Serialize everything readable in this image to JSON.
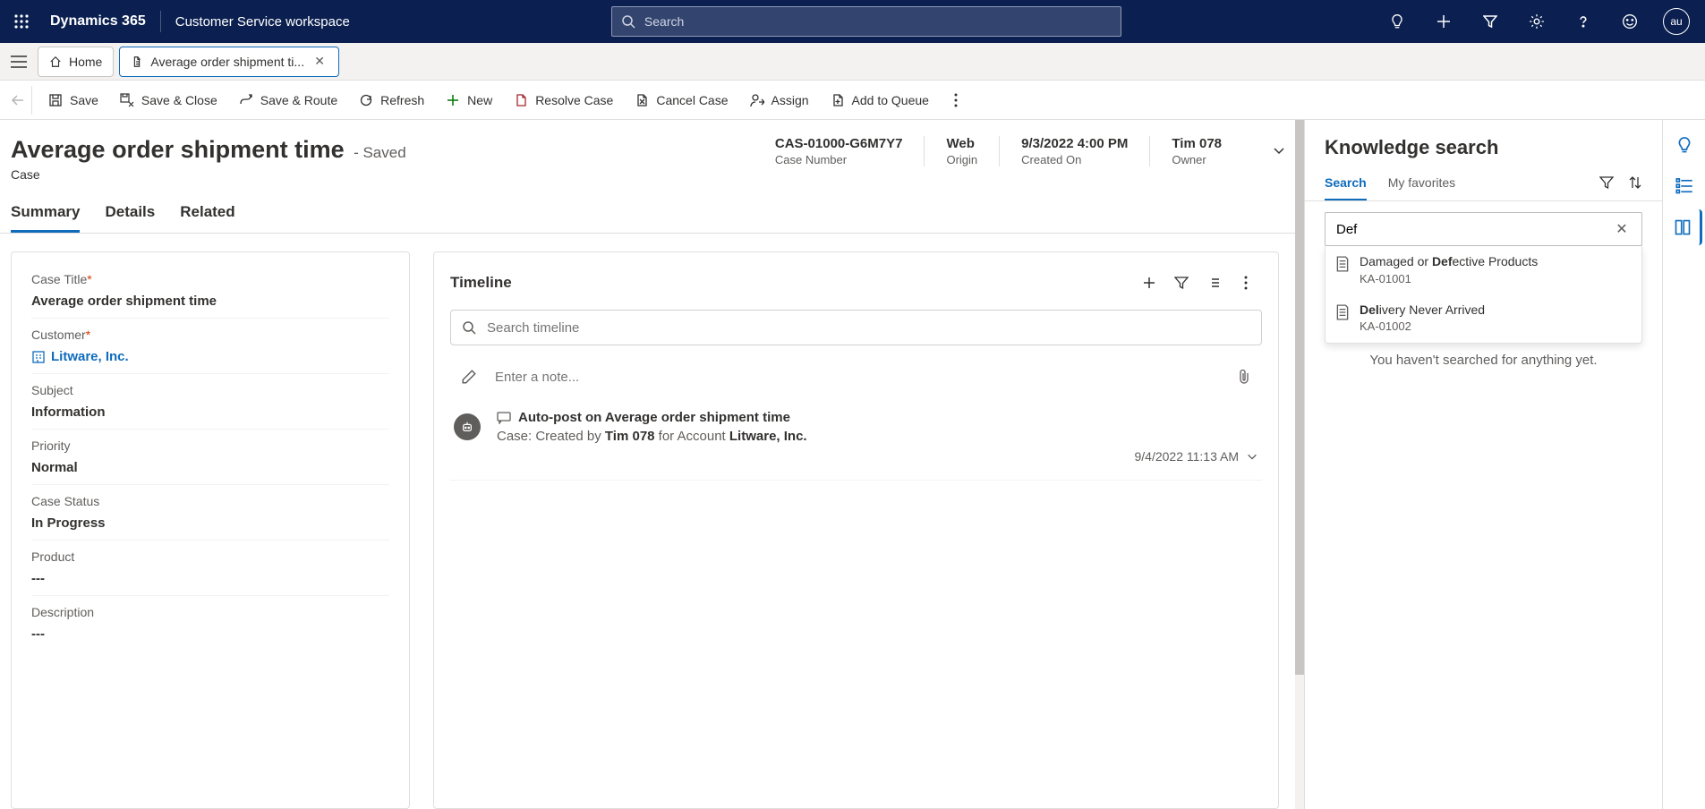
{
  "nav": {
    "brand": "Dynamics 365",
    "workspace": "Customer Service workspace",
    "search_placeholder": "Search",
    "avatar": "au"
  },
  "tabs": {
    "home": "Home",
    "active": "Average order shipment ti..."
  },
  "commands": {
    "save": "Save",
    "save_close": "Save & Close",
    "save_route": "Save & Route",
    "refresh": "Refresh",
    "new": "New",
    "resolve": "Resolve Case",
    "cancel": "Cancel Case",
    "assign": "Assign",
    "queue": "Add to Queue"
  },
  "record": {
    "title": "Average order shipment time",
    "saved": "- Saved",
    "entity": "Case",
    "header_fields": [
      {
        "value": "CAS-01000-G6M7Y7",
        "label": "Case Number"
      },
      {
        "value": "Web",
        "label": "Origin"
      },
      {
        "value": "9/3/2022 4:00 PM",
        "label": "Created On"
      },
      {
        "value": "Tim 078",
        "label": "Owner"
      }
    ]
  },
  "form_tabs": [
    "Summary",
    "Details",
    "Related"
  ],
  "fields": {
    "case_title_label": "Case Title",
    "case_title_value": "Average order shipment time",
    "customer_label": "Customer",
    "customer_value": "Litware, Inc.",
    "subject_label": "Subject",
    "subject_value": "Information",
    "priority_label": "Priority",
    "priority_value": "Normal",
    "status_label": "Case Status",
    "status_value": "In Progress",
    "product_label": "Product",
    "product_value": "---",
    "description_label": "Description",
    "description_value": "---"
  },
  "timeline": {
    "title": "Timeline",
    "search_placeholder": "Search timeline",
    "note_placeholder": "Enter a note...",
    "item_title": "Auto-post on Average order shipment time",
    "item_line_prefix": "Case: Created by ",
    "item_user": "Tim 078",
    "item_mid": " for Account ",
    "item_account": "Litware, Inc.",
    "item_time": "9/4/2022 11:13 AM"
  },
  "knowledge": {
    "title": "Knowledge search",
    "tabs": [
      "Search",
      "My favorites"
    ],
    "search_value": "Def",
    "results": [
      {
        "pre": "Damaged or ",
        "bold": "Def",
        "post": "ective Products",
        "id": "KA-01001"
      },
      {
        "pre": "",
        "bold": "Del",
        "post": "ivery Never Arrived",
        "id": "KA-01002"
      }
    ],
    "empty": "You haven't searched for anything yet."
  }
}
